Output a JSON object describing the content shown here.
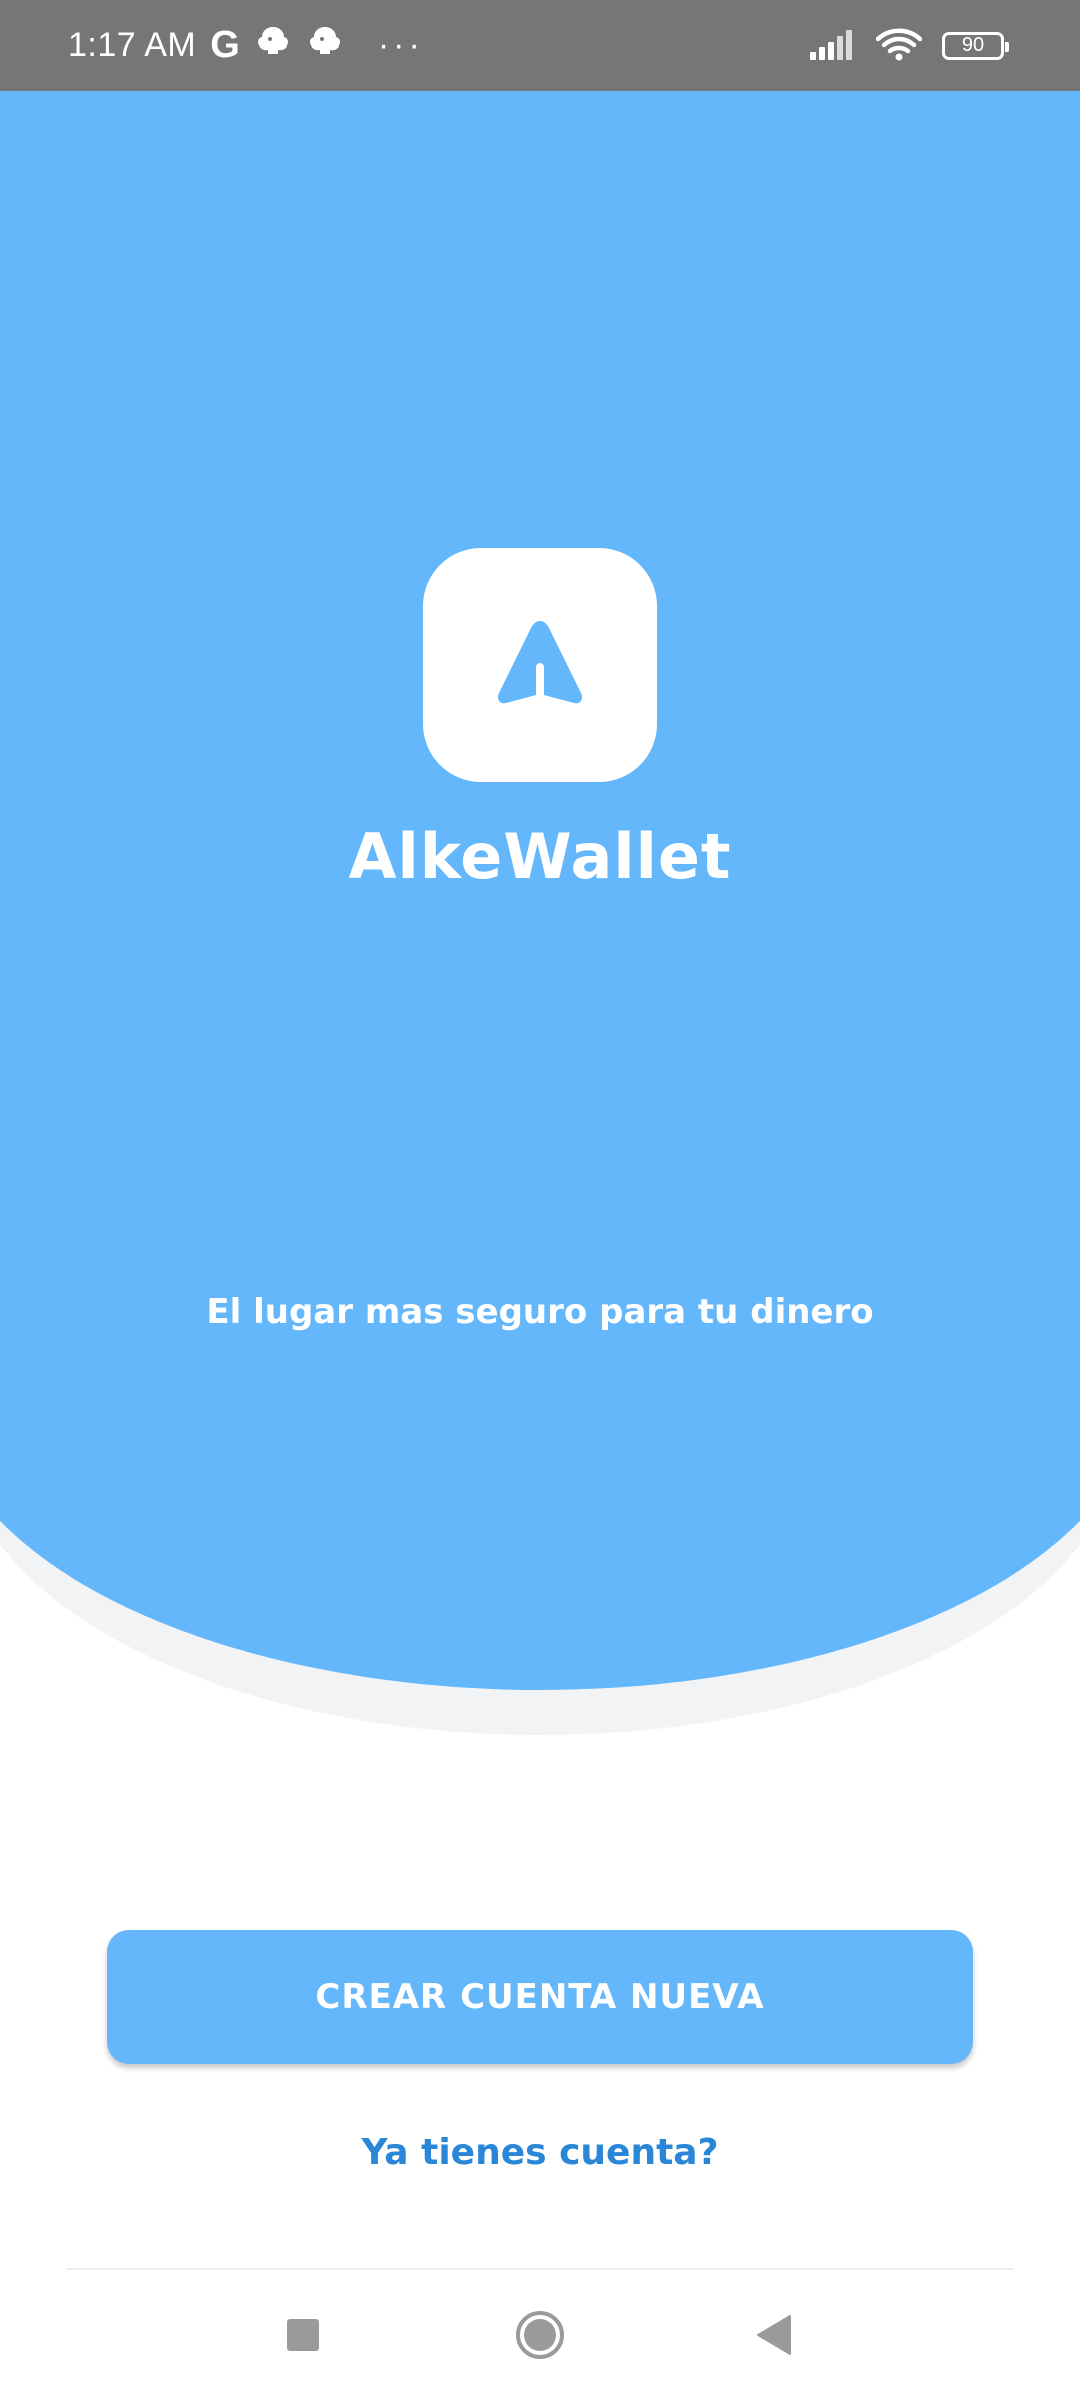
{
  "status_bar": {
    "time": "1:17 AM",
    "carrier_glyph": "G",
    "dots": "···",
    "battery": "90",
    "icons": [
      "google-icon",
      "notification-icon",
      "notification-icon",
      "signal-icon",
      "wifi-icon",
      "battery-icon"
    ]
  },
  "hero": {
    "app_name": "AlkeWallet",
    "tagline": "El lugar mas seguro para tu dinero",
    "logo_icon": "send-arrow-icon"
  },
  "actions": {
    "create_account": "CREAR CUENTA NUEVA",
    "login_link": "Ya tienes cuenta?"
  },
  "nav": {
    "icons": [
      "recents-icon",
      "home-icon",
      "back-icon"
    ]
  },
  "colors": {
    "primary": "#64b7fa",
    "link": "#2a86d6",
    "status_bar": "#767676",
    "shadow_curve": "#f1f3f5"
  }
}
